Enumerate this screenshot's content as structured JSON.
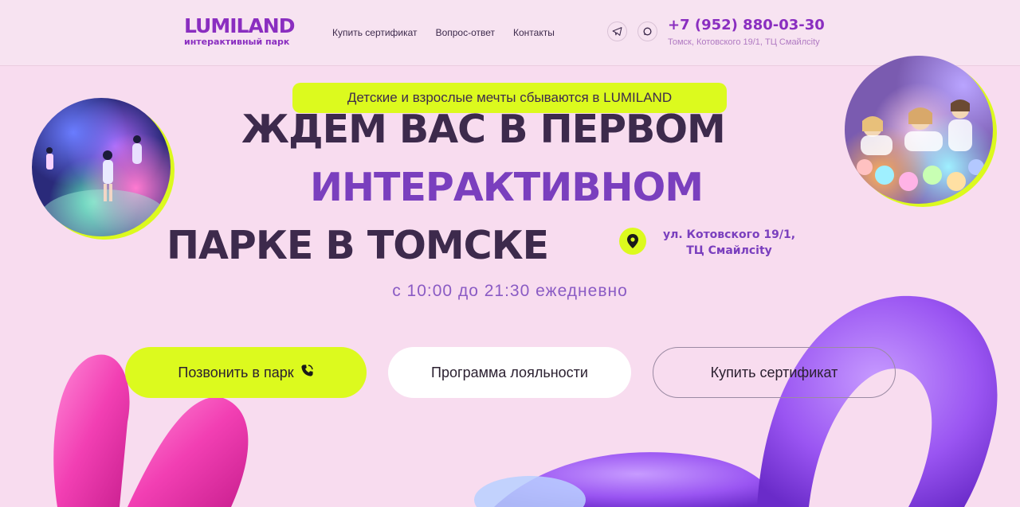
{
  "header": {
    "logo_title": "LUMILAND",
    "logo_subtitle": "интерактивный парк",
    "nav": [
      "Купить сертификат",
      "Вопрос-ответ",
      "Контакты"
    ],
    "phone": "+7 (952) 880-03-30",
    "address": "Томск, Котовского 19/1, ТЦ Смайлcity",
    "icons": [
      "telegram-icon",
      "whatsapp-icon"
    ]
  },
  "hero": {
    "pill": "Детские и взрослые мечты сбываются в LUMILAND",
    "line1": "ЖДЕМ ВАС В ПЕРВОМ",
    "line2": "ИНТЕРАКТИВНОМ",
    "line3": "ПАРКЕ В ТОМСКЕ",
    "address_line1": "ул. Котовского 19/1,",
    "address_line2": "ТЦ Смайлcity",
    "hours": "с 10:00 до 21:30 ежедневно"
  },
  "buttons": {
    "call": "Позвонить в парк",
    "loyalty": "Программа лояльности",
    "certificate": "Купить сертификат"
  },
  "colors": {
    "accent": "#dcfa1e",
    "brand": "#8a2ec0",
    "headline": "#3d2a4c",
    "headline_purple": "#7a3fbe",
    "background": "#f8dcef"
  }
}
